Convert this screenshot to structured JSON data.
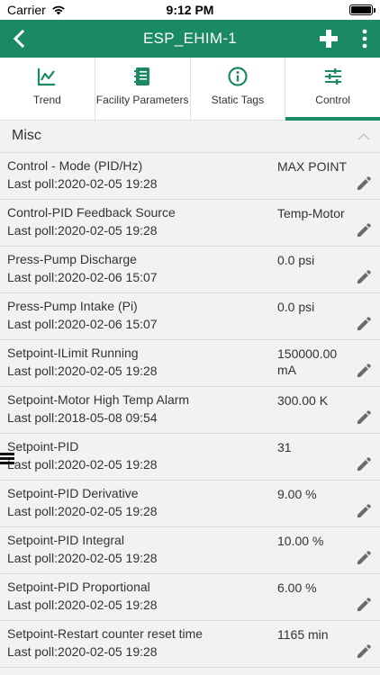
{
  "status_bar": {
    "carrier": "Carrier",
    "time": "9:12 PM"
  },
  "nav": {
    "title": "ESP_EHIM-1",
    "back_icon": "chevron-left-icon",
    "add_icon": "plus-icon",
    "more_icon": "vertical-dots-icon"
  },
  "tabs": [
    {
      "label": "Trend",
      "icon": "trend-chart-icon",
      "active": false
    },
    {
      "label": "Facility Parameters",
      "icon": "ledger-book-icon",
      "active": false
    },
    {
      "label": "Static Tags",
      "icon": "info-icon",
      "active": false
    },
    {
      "label": "Control",
      "icon": "sliders-icon",
      "active": true
    }
  ],
  "section": {
    "title": "Misc",
    "collapse_icon": "chevron-up-icon"
  },
  "rows": [
    {
      "name": "Control - Mode (PID/Hz)",
      "poll": "Last poll:2020-02-05 19:28",
      "value": "MAX POINT"
    },
    {
      "name": "Control-PID Feedback Source",
      "poll": "Last poll:2020-02-05 19:28",
      "value": "Temp-Motor"
    },
    {
      "name": "Press-Pump Discharge",
      "poll": "Last poll:2020-02-06 15:07",
      "value": "0.0 psi"
    },
    {
      "name": "Press-Pump Intake (Pi)",
      "poll": "Last poll:2020-02-06 15:07",
      "value": "0.0 psi"
    },
    {
      "name": "Setpoint-ILimit Running",
      "poll": "Last poll:2020-02-05 19:28",
      "value": "150000.00 mA"
    },
    {
      "name": "Setpoint-Motor High Temp Alarm",
      "poll": "Last poll:2018-05-08 09:54",
      "value": "300.00 K"
    },
    {
      "name": "Setpoint-PID",
      "poll": "Last poll:2020-02-05 19:28",
      "value": "31"
    },
    {
      "name": "Setpoint-PID Derivative",
      "poll": "Last poll:2020-02-05 19:28",
      "value": "9.00 %"
    },
    {
      "name": "Setpoint-PID Integral",
      "poll": "Last poll:2020-02-05 19:28",
      "value": "10.00 %"
    },
    {
      "name": "Setpoint-PID Proportional",
      "poll": "Last poll:2020-02-05 19:28",
      "value": "6.00 %"
    },
    {
      "name": "Setpoint-Restart counter reset time",
      "poll": "Last poll:2020-02-05 19:28",
      "value": "1165 min"
    }
  ],
  "colors": {
    "accent": "#1a8a63",
    "text": "#333333",
    "icon_gray": "#6b6b6b"
  }
}
